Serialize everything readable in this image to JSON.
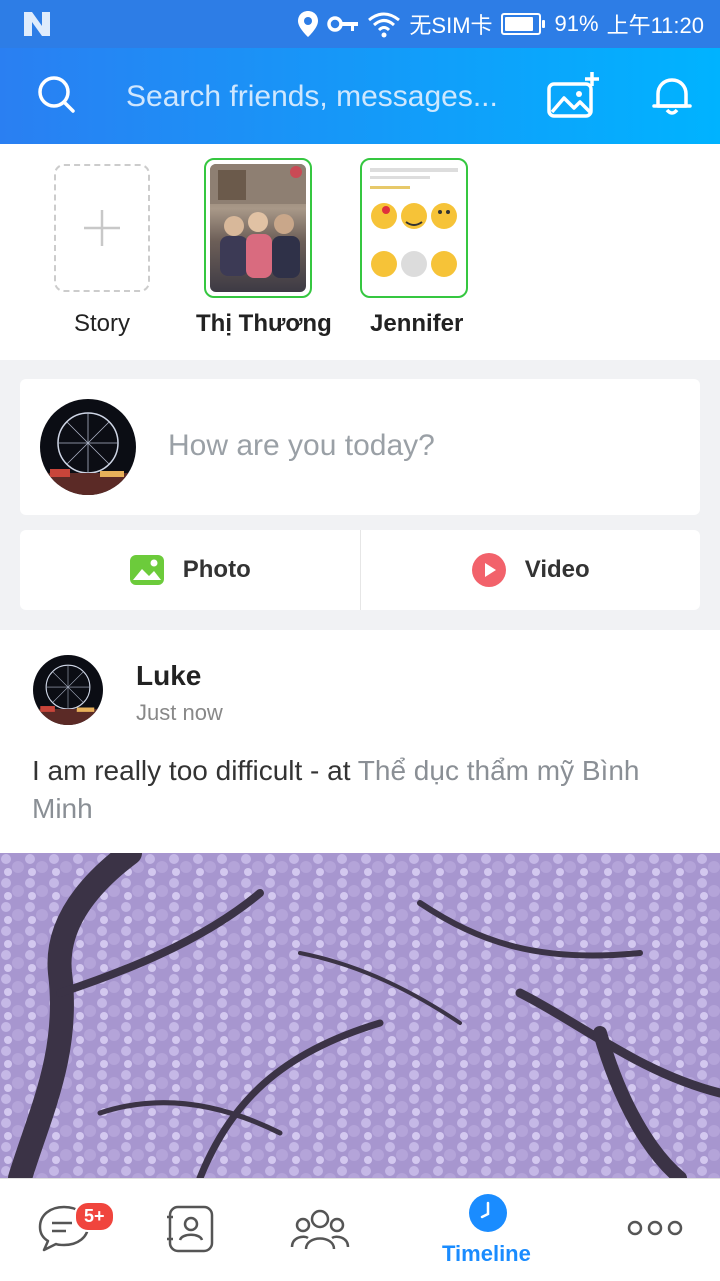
{
  "status_bar": {
    "carrier": "无SIM卡",
    "battery": "91%",
    "battery_level": 0.91,
    "time": "上午11:20"
  },
  "search": {
    "placeholder": "Search friends, messages..."
  },
  "stories": [
    {
      "label": "Story"
    },
    {
      "label": "Thị Thương"
    },
    {
      "label": "Jennifer"
    }
  ],
  "composer": {
    "prompt": "How are you today?",
    "photo_label": "Photo",
    "video_label": "Video"
  },
  "post": {
    "author": "Luke",
    "time": "Just now",
    "text": "I am really too difficult - at ",
    "place": "Thể dục thẩm mỹ Bình Minh"
  },
  "bottom_nav": {
    "messages_badge": "5+",
    "timeline_label": "Timeline"
  },
  "colors": {
    "accent": "#1a8cff",
    "story_ring": "#35c740",
    "badge": "#f0453d"
  }
}
